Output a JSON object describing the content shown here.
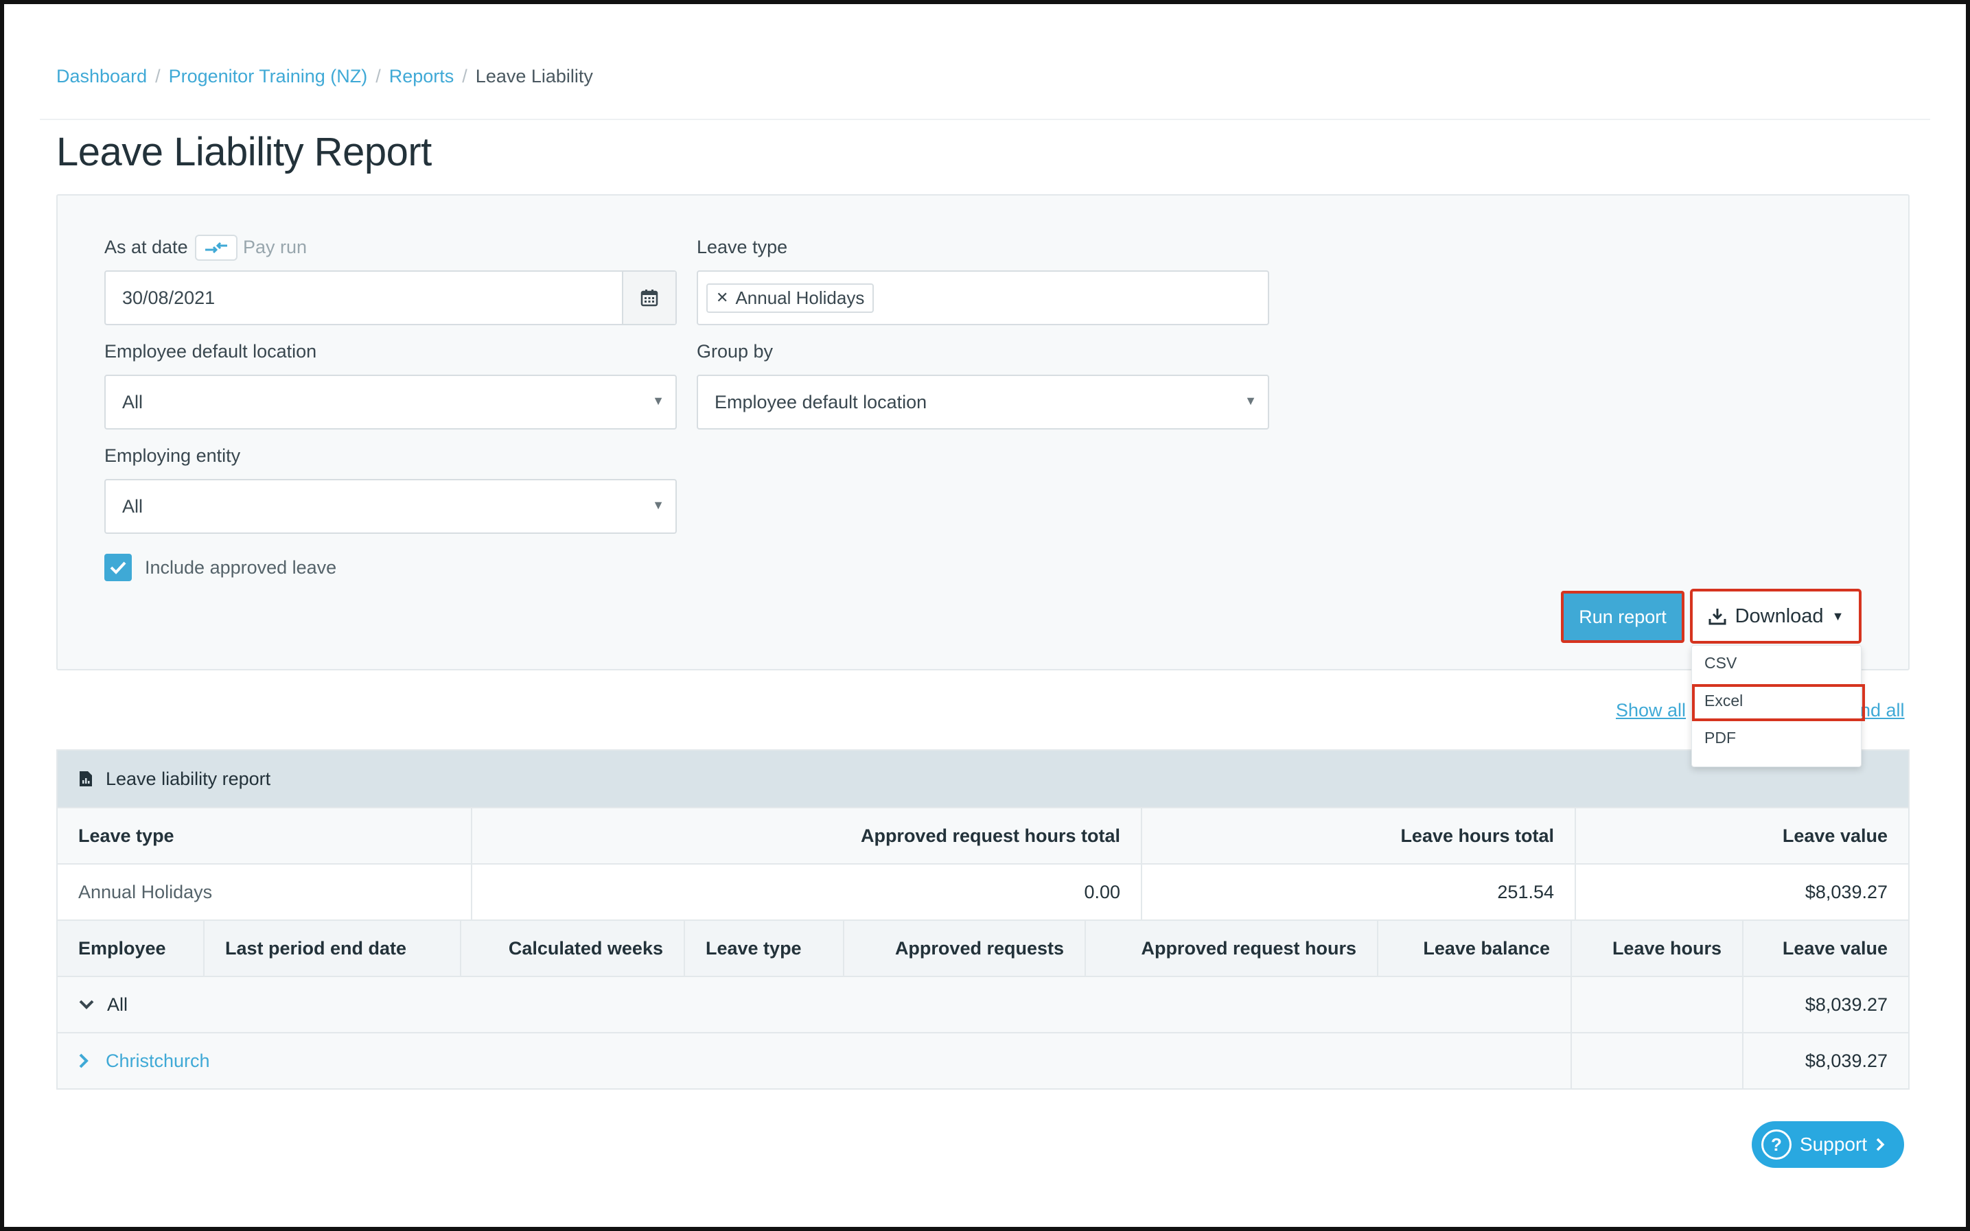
{
  "breadcrumb": {
    "items": [
      "Dashboard",
      "Progenitor Training (NZ)",
      "Reports"
    ],
    "separator": "/",
    "current": "Leave Liability"
  },
  "page": {
    "title": "Leave Liability Report"
  },
  "filters": {
    "as_at_date_label": "As at date",
    "pay_run_label": "Pay run",
    "as_at_date_value": "30/08/2021",
    "leave_type_label": "Leave type",
    "leave_type_tag": "Annual Holidays",
    "employee_location_label": "Employee default location",
    "employee_location_value": "All",
    "group_by_label": "Group by",
    "group_by_value": "Employee default location",
    "employing_entity_label": "Employing entity",
    "employing_entity_value": "All",
    "include_approved_label": "Include approved leave",
    "include_approved_checked": true
  },
  "actions": {
    "run_report": "Run report",
    "download": "Download",
    "download_options": [
      "CSV",
      "Excel",
      "PDF"
    ]
  },
  "links": {
    "show_all": "Show all",
    "expand_all": "nd all"
  },
  "report": {
    "title": "Leave liability report",
    "summary_headers": [
      "Leave type",
      "Approved request hours total",
      "Leave hours total",
      "Leave value"
    ],
    "summary_row": [
      "Annual Holidays",
      "0.00",
      "251.54",
      "$8,039.27"
    ],
    "detail_headers": [
      "Employee",
      "Last period end date",
      "Calculated weeks",
      "Leave type",
      "Approved requests",
      "Approved request hours",
      "Leave balance",
      "Leave hours",
      "Leave value"
    ],
    "group_all_label": "All",
    "group_all_value": "$8,039.27",
    "group_christchurch_label": "Christchurch",
    "group_christchurch_value": "$8,039.27"
  },
  "support": {
    "label": "Support"
  },
  "colors": {
    "accent": "#3fa9d6",
    "highlight": "#d6341f",
    "support": "#29a8e0"
  }
}
